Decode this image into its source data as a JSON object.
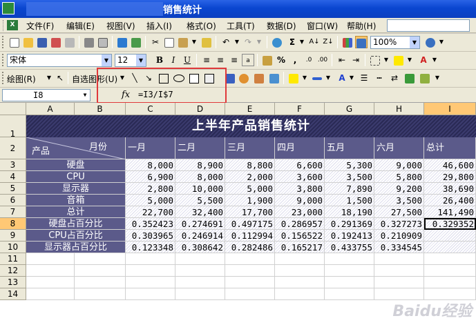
{
  "window": {
    "title": "销售统计"
  },
  "menu": [
    "文件(F)",
    "编辑(E)",
    "视图(V)",
    "插入(I)",
    "格式(O)",
    "工具(T)",
    "数据(D)",
    "窗口(W)",
    "帮助(H)"
  ],
  "standard_toolbar": {
    "zoom": "100%"
  },
  "format_toolbar": {
    "font": "宋体",
    "size": "12",
    "bold": "B",
    "italic": "I",
    "underline": "U",
    "percent": "%",
    "comma": ",",
    "currency_label": "A"
  },
  "drawing_toolbar": {
    "draw_label": "绘图(R)",
    "autoshape_label": "自选图形(U)"
  },
  "formula_bar": {
    "name_box": "I8",
    "fx": "fx",
    "formula": "=I3/I$7"
  },
  "columns": [
    "A",
    "B",
    "C",
    "D",
    "E",
    "F",
    "G",
    "H",
    "I"
  ],
  "rows": [
    "1",
    "2",
    "3",
    "4",
    "5",
    "6",
    "7",
    "8",
    "9",
    "10",
    "11",
    "12",
    "13",
    "14"
  ],
  "sheet": {
    "banner": "上半年产品销售统计",
    "corner_top": "月份",
    "corner_bottom": "产品",
    "months": [
      "一月",
      "二月",
      "三月",
      "四月",
      "五月",
      "六月",
      "总计"
    ],
    "data_rows": [
      {
        "label": "硬盘",
        "values": [
          "8,000",
          "8,900",
          "8,800",
          "6,600",
          "5,300",
          "9,000",
          "46,600"
        ]
      },
      {
        "label": "CPU",
        "values": [
          "6,900",
          "8,000",
          "2,000",
          "3,600",
          "3,500",
          "5,800",
          "29,800"
        ]
      },
      {
        "label": "显示器",
        "values": [
          "2,800",
          "10,000",
          "5,000",
          "3,800",
          "7,890",
          "9,200",
          "38,690"
        ]
      },
      {
        "label": "音箱",
        "values": [
          "5,000",
          "5,500",
          "1,900",
          "9,000",
          "1,500",
          "3,500",
          "26,400"
        ]
      },
      {
        "label": "总计",
        "values": [
          "22,700",
          "32,400",
          "17,700",
          "23,000",
          "18,190",
          "27,500",
          "141,490"
        ]
      },
      {
        "label": "硬盘占百分比",
        "values": [
          "0.352423",
          "0.274691",
          "0.497175",
          "0.286957",
          "0.291369",
          "0.327273",
          "0.329352"
        ]
      },
      {
        "label": "CPU占百分比",
        "values": [
          "0.303965",
          "0.246914",
          "0.112994",
          "0.156522",
          "0.192413",
          "0.210909",
          ""
        ]
      },
      {
        "label": "显示器占百分比",
        "values": [
          "0.123348",
          "0.308642",
          "0.282486",
          "0.165217",
          "0.433755",
          "0.334545",
          ""
        ]
      }
    ]
  },
  "watermark": "Baidu经验"
}
